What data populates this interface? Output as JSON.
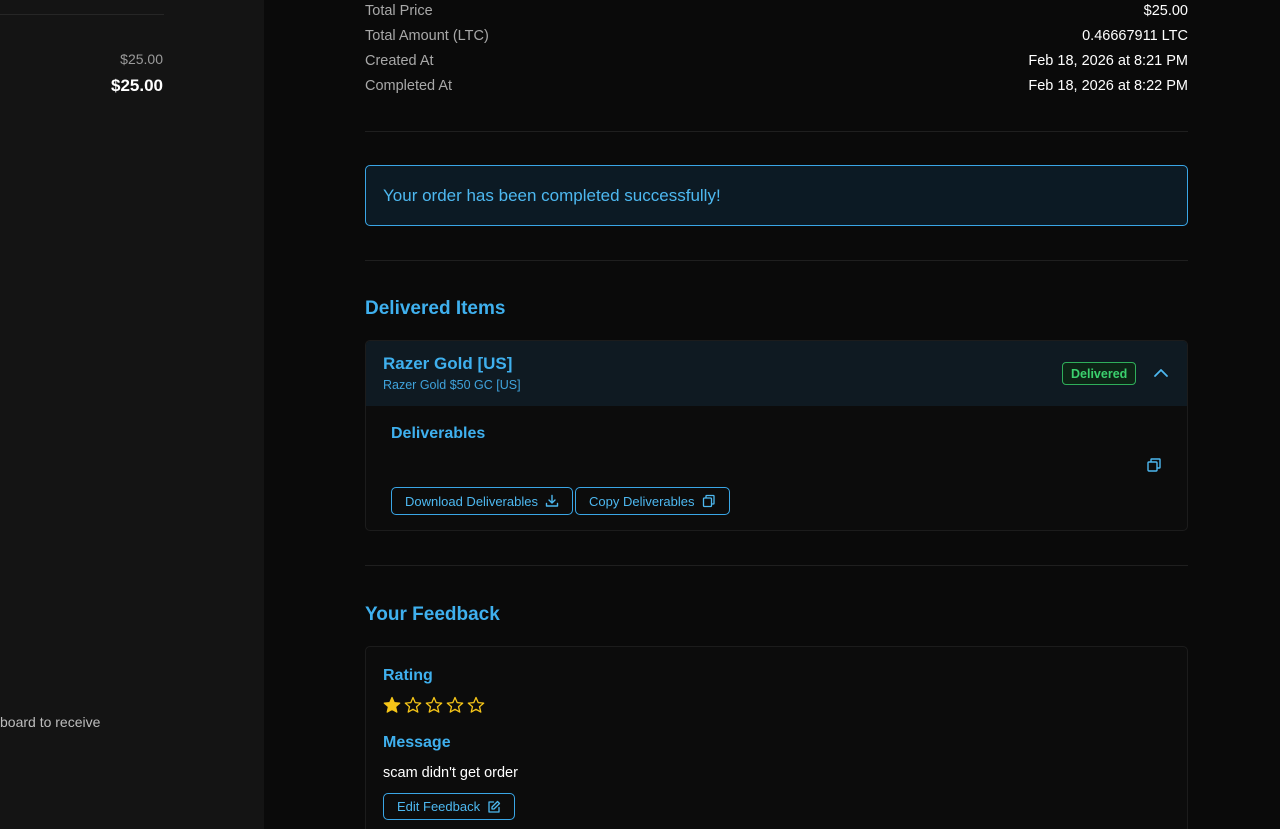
{
  "left_panel": {
    "subtotal": "$25.00",
    "total": "$25.00",
    "partial_text": "board to receive"
  },
  "order_info": {
    "rows": [
      {
        "label": "Total Price",
        "value": "$25.00"
      },
      {
        "label": "Total Amount (LTC)",
        "value": "0.46667911 LTC"
      },
      {
        "label": "Created At",
        "value": "Feb 18, 2026 at 8:21 PM"
      },
      {
        "label": "Completed At",
        "value": "Feb 18, 2026 at 8:22 PM"
      }
    ]
  },
  "success_message": "Your order has been completed successfully!",
  "delivered": {
    "title": "Delivered Items",
    "item": {
      "name": "Razer Gold [US]",
      "subtitle": "Razer Gold $50 GC [US]",
      "status": "Delivered",
      "deliverables_title": "Deliverables",
      "download_label": "Download Deliverables",
      "copy_label": "Copy Deliverables"
    }
  },
  "feedback": {
    "title": "Your Feedback",
    "rating_label": "Rating",
    "rating": 1,
    "rating_max": 5,
    "message_label": "Message",
    "message": "scam didn't get order",
    "edit_label": "Edit Feedback"
  },
  "colors": {
    "accent": "#3fb0ee",
    "success": "#3bd06e",
    "star_filled": "#f5c518"
  }
}
